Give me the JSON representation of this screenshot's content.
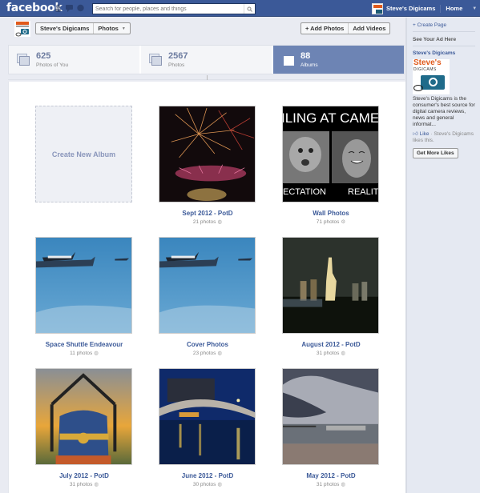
{
  "topbar": {
    "logo": "facebook",
    "search_placeholder": "Search for people, places and things",
    "profile_name": "Steve's Digicams",
    "home_label": "Home",
    "brand_color": "#3b5998"
  },
  "page_header": {
    "page_name": "Steve's Digicams",
    "section": "Photos",
    "add_photos": "+ Add Photos",
    "add_videos": "Add Videos"
  },
  "stats": [
    {
      "count": "625",
      "label": "Photos of You",
      "active": false
    },
    {
      "count": "2567",
      "label": "Photos",
      "active": false
    },
    {
      "count": "88",
      "label": "Albums",
      "active": true
    }
  ],
  "albums": {
    "create_label": "Create New Album",
    "items": [
      {
        "title": "Sept 2012 - PotD",
        "count": "21 photos",
        "privacy": "public",
        "cover": "fireworks"
      },
      {
        "title": "Wall Photos",
        "count": "71 photos",
        "privacy": "settings",
        "cover": "cat-meme",
        "cover_text_top": "ILING AT CAME",
        "cover_text_left": "ECTATION",
        "cover_text_right": "REALIT"
      },
      {
        "title": "Space Shuttle Endeavour",
        "count": "11 photos",
        "privacy": "public",
        "cover": "shuttle"
      },
      {
        "title": "Cover Photos",
        "count": "23 photos",
        "privacy": "public",
        "cover": "shuttle"
      },
      {
        "title": "August 2012 - PotD",
        "count": "31 photos",
        "privacy": "public",
        "cover": "statue-night"
      },
      {
        "title": "July 2012 - PotD",
        "count": "31 photos",
        "privacy": "public",
        "cover": "train"
      },
      {
        "title": "June 2012 - PotD",
        "count": "30 photos",
        "privacy": "public",
        "cover": "bridge-night"
      },
      {
        "title": "May 2012 - PotD",
        "count": "31 photos",
        "privacy": "public",
        "cover": "beach-clouds"
      }
    ]
  },
  "sidebar": {
    "create_page": "+ Create Page",
    "ad_heading": "See Your Ad Here",
    "ad_page_name": "Steve's Digicams",
    "logo_top": "Steve's",
    "logo_bottom": "DIGICAMS",
    "description": "Steve's Digicams is the consumer's best source for digital camera reviews, news and general informat...",
    "like_label": "Like",
    "like_text": " · Steve's Digicams likes this.",
    "get_more_likes": "Get More Likes"
  }
}
